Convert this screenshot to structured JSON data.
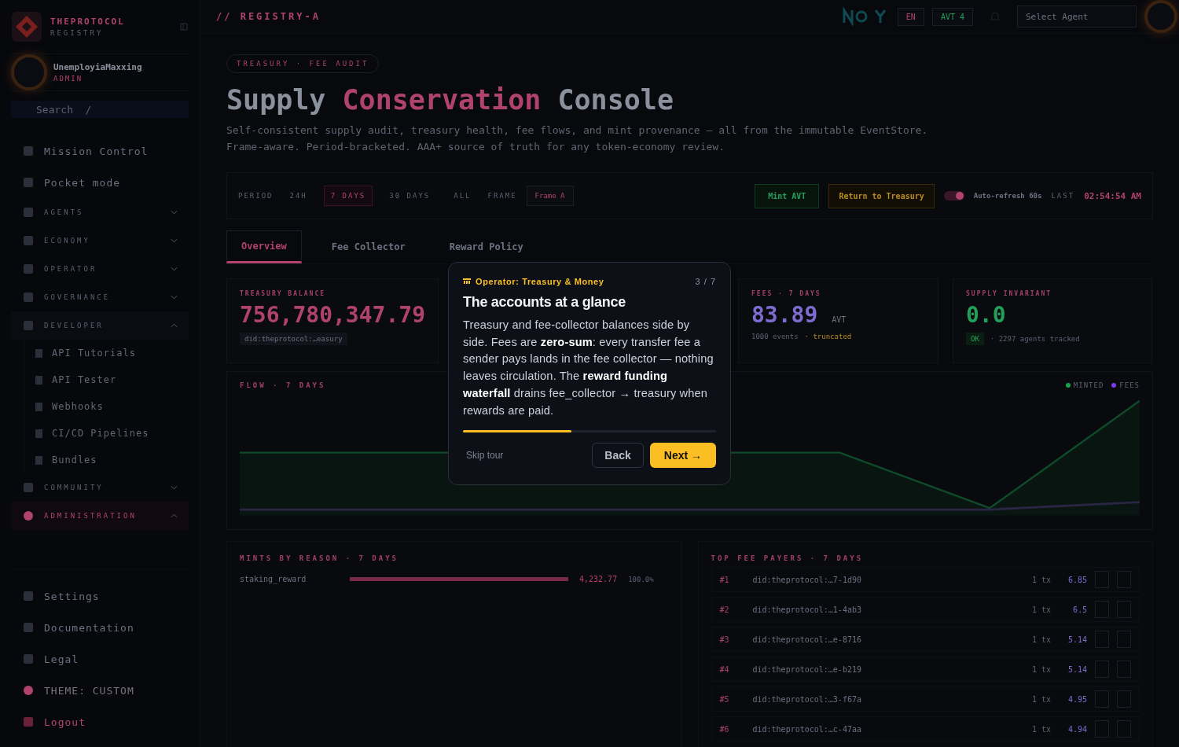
{
  "sidebar": {
    "brand": {
      "name": "THEPROTOCOL",
      "sub": "REGISTRY"
    },
    "user": {
      "name": "UnemployiaMaxxing",
      "role": "ADMIN"
    },
    "search": {
      "placeholder": "Search  /"
    },
    "items": [
      {
        "kind": "link",
        "label": "Mission Control"
      },
      {
        "kind": "link",
        "label": "Pocket mode"
      },
      {
        "kind": "section",
        "label": "AGENTS",
        "expanded": false
      },
      {
        "kind": "section",
        "label": "ECONOMY",
        "expanded": false
      },
      {
        "kind": "section",
        "label": "OPERATOR",
        "expanded": false
      },
      {
        "kind": "section",
        "label": "GOVERNANCE",
        "expanded": false
      },
      {
        "kind": "section",
        "label": "DEVELOPER",
        "expanded": true,
        "children": [
          {
            "label": "API Tutorials"
          },
          {
            "label": "API Tester"
          },
          {
            "label": "Webhooks"
          },
          {
            "label": "CI/CD Pipelines"
          },
          {
            "label": "Bundles"
          }
        ]
      },
      {
        "kind": "section",
        "label": "COMMUNITY",
        "expanded": false
      },
      {
        "kind": "section",
        "label": "ADMINISTRATION",
        "expanded": true,
        "active": true
      }
    ],
    "footer": [
      {
        "kind": "link",
        "label": "Settings"
      },
      {
        "kind": "link",
        "label": "Documentation"
      },
      {
        "kind": "link",
        "label": "Legal"
      },
      {
        "kind": "theme",
        "label": "THEME: CUSTOM"
      },
      {
        "kind": "logout",
        "label": "Logout"
      }
    ]
  },
  "header": {
    "breadcrumb": "// REGISTRY-A",
    "language": "EN",
    "token": "AVT",
    "token_count": "4",
    "agent_select": {
      "placeholder": "Select Agent"
    }
  },
  "page": {
    "badge": "TREASURY · FEE AUDIT",
    "title": [
      {
        "text": "Supply",
        "accent": false
      },
      {
        "text": "Conservation",
        "accent": true
      },
      {
        "text": "Console",
        "accent": false
      }
    ],
    "subtitle": "Self-consistent supply audit, treasury health, fee flows, and mint provenance — all from the immutable EventStore. Frame-aware. Period-bracketed. AAA+ source of truth for any token-economy review.",
    "toolbar": {
      "period_label": "PERIOD",
      "periods": [
        {
          "label": "24H",
          "selected": false
        },
        {
          "label": "7 DAYS",
          "selected": true
        },
        {
          "label": "30 DAYS",
          "selected": false
        },
        {
          "label": "ALL",
          "selected": false
        }
      ],
      "frame_label": "FRAME",
      "frame": "Frame A",
      "mint_button": "Mint AVT",
      "return_button": "Return to Treasury",
      "auto_refresh": {
        "label": "Auto-refresh 60s",
        "on": true
      },
      "last_label": "LAST",
      "last_time": "02:54:54 AM"
    },
    "tabs": [
      {
        "label": "Overview",
        "selected": true
      },
      {
        "label": "Fee Collector",
        "selected": false
      },
      {
        "label": "Reward Policy",
        "selected": false
      }
    ],
    "stats": [
      {
        "kind": "treasury",
        "label": "TREASURY BALANCE",
        "value": "756,780,347.79",
        "chip": "did:theprotocol:…easury"
      },
      {
        "kind": "fees",
        "label": "FEES · 7 DAYS",
        "value": "83.89",
        "unit": "AVT",
        "note": "1000 events",
        "warning": "· truncated"
      },
      {
        "kind": "invariant",
        "label": "SUPPLY INVARIANT",
        "value": "0.0",
        "chip": "OK",
        "note": "· 2297 agents tracked"
      }
    ],
    "flow": {
      "title": "FLOW · 7 DAYS",
      "legend": [
        {
          "label": "MINTED",
          "color": "#16a34a"
        },
        {
          "label": "FEES",
          "color": "#7c3aed"
        }
      ]
    },
    "mints": {
      "title": "MINTS BY REASON · 7 DAYS",
      "rows": [
        {
          "reason": "staking_reward",
          "level": 1.0,
          "amount": "4,232.77",
          "share": "100.0%"
        }
      ]
    },
    "payers": {
      "title": "TOP FEE PAYERS · 7 DAYS",
      "rows": [
        {
          "rank": "#1",
          "id": "did:theprotocol:…7-1d90",
          "tx": "1 tx",
          "amount": "6.85"
        },
        {
          "rank": "#2",
          "id": "did:theprotocol:…1-4ab3",
          "tx": "1 tx",
          "amount": "6.5"
        },
        {
          "rank": "#3",
          "id": "did:theprotocol:…e-8716",
          "tx": "1 tx",
          "amount": "5.14"
        },
        {
          "rank": "#4",
          "id": "did:theprotocol:…e-b219",
          "tx": "1 tx",
          "amount": "5.14"
        },
        {
          "rank": "#5",
          "id": "did:theprotocol:…3-f67a",
          "tx": "1 tx",
          "amount": "4.95"
        },
        {
          "rank": "#6",
          "id": "did:theprotocol:…c-47aa",
          "tx": "1 tx",
          "amount": "4.94"
        }
      ]
    }
  },
  "tour": {
    "category": "Operator: Treasury & Money",
    "step": "3 / 7",
    "title": "The accounts at a glance",
    "body": "Treasury and fee-collector balances side by side. Fees are **zero-sum**: every transfer fee a sender pays lands in the fee collector — nothing leaves circulation. The **reward funding waterfall** drains fee_collector → treasury when rewards are paid.",
    "level": 0.43,
    "skip": "Skip tour",
    "back": "Back",
    "next": "Next →"
  }
}
